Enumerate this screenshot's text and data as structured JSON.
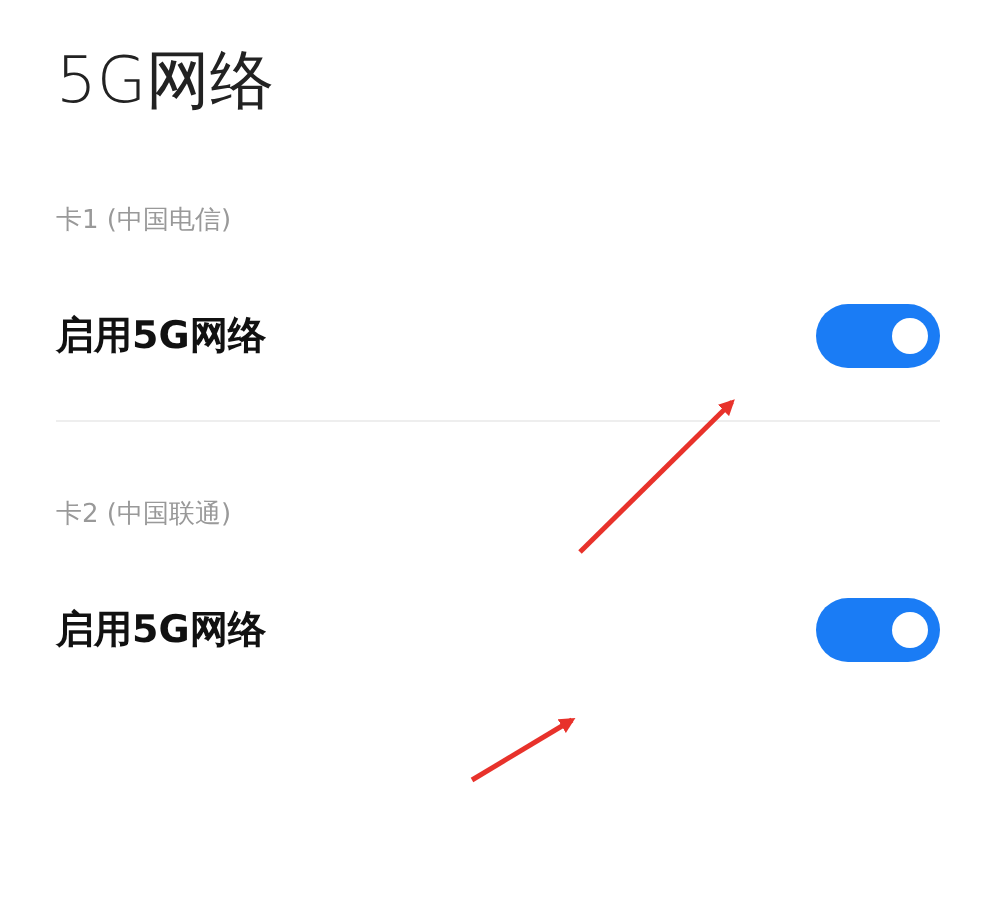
{
  "title": "5G网络",
  "sims": [
    {
      "label": "卡1 (中国电信)",
      "setting": "启用5G网络",
      "on": true
    },
    {
      "label": "卡2 (中国联通)",
      "setting": "启用5G网络",
      "on": true
    }
  ]
}
